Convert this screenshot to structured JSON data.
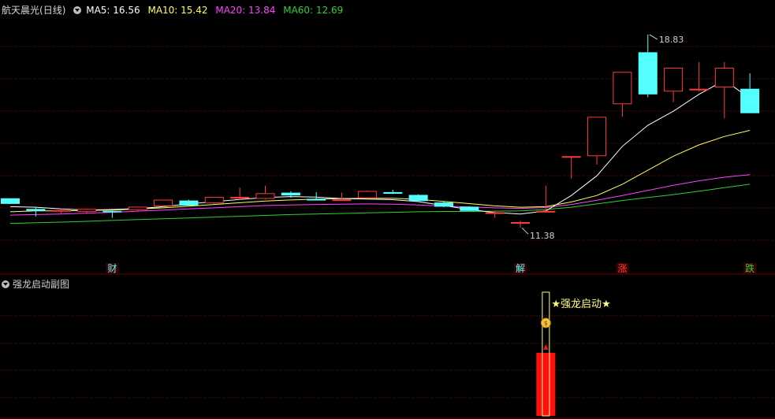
{
  "header": {
    "stock_name": "航天晨光",
    "period": "(日线)",
    "ma5_label": "MA5: 16.56",
    "ma10_label": "MA10: 15.42",
    "ma20_label": "MA20: 13.84",
    "ma60_label": "MA60: 12.69"
  },
  "sub_panel": {
    "title": "强龙启动副图",
    "signal_label": "★强龙启动★"
  },
  "colors": {
    "up": "#ff3b3b",
    "down": "#54ffff",
    "ma5": "#ffffff",
    "ma10": "#ffff5a",
    "ma20": "#ff40ff",
    "ma60": "#30d030",
    "grid": "#7a0000",
    "signal_bar": "#ff1010",
    "signal_box": "#ffff80"
  },
  "chart_data": {
    "type": "candlestick",
    "price_range": [
      10.3,
      19.5
    ],
    "candles": [
      {
        "o": 13.0,
        "h": 13.0,
        "c": 12.8,
        "l": 12.8
      },
      {
        "o": 12.62,
        "h": 12.7,
        "c": 12.55,
        "l": 12.35
      },
      {
        "o": 12.55,
        "h": 12.62,
        "c": 12.58,
        "l": 12.45
      },
      {
        "o": 12.52,
        "h": 12.6,
        "c": 12.62,
        "l": 12.45
      },
      {
        "o": 12.55,
        "h": 12.62,
        "c": 12.5,
        "l": 12.3
      },
      {
        "o": 12.58,
        "h": 12.7,
        "c": 12.7,
        "l": 12.52
      },
      {
        "o": 12.72,
        "h": 12.95,
        "c": 12.95,
        "l": 12.7
      },
      {
        "o": 12.92,
        "h": 12.95,
        "c": 12.74,
        "l": 12.74
      },
      {
        "o": 12.82,
        "h": 13.05,
        "c": 13.05,
        "l": 12.8
      },
      {
        "o": 13.0,
        "h": 13.38,
        "c": 13.05,
        "l": 12.94
      },
      {
        "o": 12.98,
        "h": 13.45,
        "c": 13.18,
        "l": 12.96
      },
      {
        "o": 13.2,
        "h": 13.25,
        "c": 13.1,
        "l": 13.02
      },
      {
        "o": 12.98,
        "h": 13.22,
        "c": 12.92,
        "l": 12.92
      },
      {
        "o": 12.92,
        "h": 13.2,
        "c": 12.96,
        "l": 12.92
      },
      {
        "o": 13.0,
        "h": 13.28,
        "c": 13.26,
        "l": 12.98
      },
      {
        "o": 13.22,
        "h": 13.3,
        "c": 13.16,
        "l": 13.15
      },
      {
        "o": 13.12,
        "h": 13.14,
        "c": 12.9,
        "l": 12.88
      },
      {
        "o": 12.85,
        "h": 12.88,
        "c": 12.7,
        "l": 12.68
      },
      {
        "o": 12.7,
        "h": 12.72,
        "c": 12.55,
        "l": 12.54
      },
      {
        "o": 12.48,
        "h": 12.54,
        "c": 12.5,
        "l": 12.3
      },
      {
        "o": 12.15,
        "h": 12.2,
        "c": 12.15,
        "l": 11.95
      },
      {
        "o": 12.55,
        "h": 13.45,
        "c": 12.55,
        "l": 12.55
      },
      {
        "o": 14.5,
        "h": 14.5,
        "c": 14.5,
        "l": 13.7
      },
      {
        "o": 14.5,
        "h": 15.9,
        "c": 15.9,
        "l": 14.2
      },
      {
        "o": 16.35,
        "h": 17.5,
        "c": 17.5,
        "l": 15.9
      },
      {
        "o": 18.2,
        "h": 18.83,
        "c": 16.7,
        "l": 16.6
      },
      {
        "o": 16.8,
        "h": 17.65,
        "c": 17.65,
        "l": 16.42
      },
      {
        "o": 16.9,
        "h": 17.85,
        "c": 16.9,
        "l": 16.8
      },
      {
        "o": 16.95,
        "h": 17.85,
        "c": 17.65,
        "l": 15.85
      },
      {
        "o": 16.9,
        "h": 17.45,
        "c": 16.03,
        "l": 16.03
      }
    ],
    "ma5": [
      12.7,
      12.68,
      12.62,
      12.58,
      12.6,
      12.63,
      12.7,
      12.8,
      12.88,
      12.96,
      13.03,
      13.06,
      13.04,
      12.99,
      12.97,
      12.95,
      12.88,
      12.74,
      12.6,
      12.49,
      12.44,
      12.55,
      13.1,
      13.8,
      14.85,
      15.6,
      16.1,
      16.7,
      17.2,
      16.56
    ],
    "ma10": [
      12.52,
      12.55,
      12.55,
      12.57,
      12.58,
      12.62,
      12.66,
      12.72,
      12.78,
      12.84,
      12.9,
      12.94,
      12.97,
      12.99,
      13.0,
      13.0,
      12.96,
      12.89,
      12.81,
      12.73,
      12.68,
      12.7,
      12.87,
      13.1,
      13.5,
      14.0,
      14.5,
      14.9,
      15.2,
      15.42
    ],
    "ma20": [
      12.4,
      12.42,
      12.44,
      12.47,
      12.5,
      12.54,
      12.58,
      12.62,
      12.66,
      12.7,
      12.74,
      12.76,
      12.78,
      12.79,
      12.8,
      12.79,
      12.76,
      12.72,
      12.69,
      12.66,
      12.64,
      12.67,
      12.78,
      12.93,
      13.1,
      13.28,
      13.46,
      13.62,
      13.75,
      13.84
    ],
    "ma60": [
      12.1,
      12.13,
      12.15,
      12.18,
      12.21,
      12.24,
      12.27,
      12.3,
      12.33,
      12.36,
      12.39,
      12.42,
      12.44,
      12.46,
      12.48,
      12.5,
      12.52,
      12.53,
      12.53,
      12.54,
      12.55,
      12.6,
      12.68,
      12.8,
      12.92,
      13.03,
      13.13,
      13.25,
      13.38,
      13.5
    ],
    "annotations": {
      "high_label": "18.83",
      "low_label": "11.38",
      "markers": [
        {
          "text": "财",
          "index": 4,
          "color": "#54ffff"
        },
        {
          "text": "解",
          "index": 20,
          "color": "#54ffff"
        },
        {
          "text": "涨",
          "index": 24,
          "color": "#ff3b3b"
        },
        {
          "text": "跌",
          "index": 29,
          "color": "#30d030"
        }
      ]
    },
    "signal_index": 21
  }
}
